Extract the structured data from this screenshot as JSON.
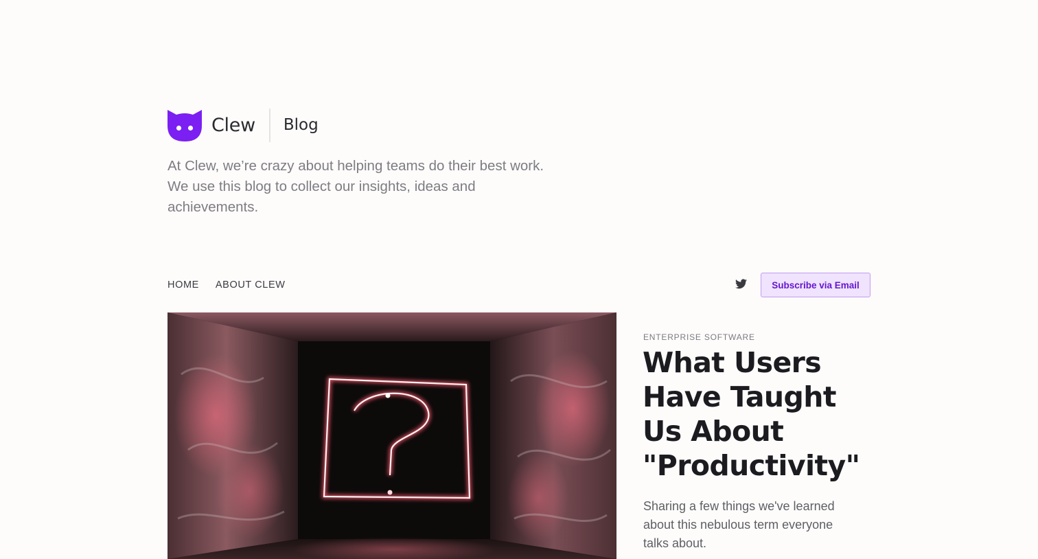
{
  "brand": {
    "name": "Clew",
    "section": "Blog",
    "logo_icon": "cat-face-icon",
    "accent_color": "#7b1ff2"
  },
  "intro": {
    "text": "At Clew, we’re crazy about helping teams do their best work. We use this blog to collect our insights, ideas and achievements."
  },
  "nav": {
    "items": [
      {
        "label": "HOME"
      },
      {
        "label": "ABOUT CLEW"
      }
    ],
    "twitter_icon": "twitter-icon",
    "subscribe_label": "Subscribe via Email",
    "subscribe_color": "#6517cf",
    "subscribe_background": "#efe3fd"
  },
  "featured_post": {
    "image_icon": "question-mark-neon-photo",
    "category": "ENTERPRISE SOFTWARE",
    "title": "What Users Have Taught Us About \"Productivity\"",
    "excerpt": "Sharing a few things we've learned about this nebulous term everyone talks about."
  }
}
